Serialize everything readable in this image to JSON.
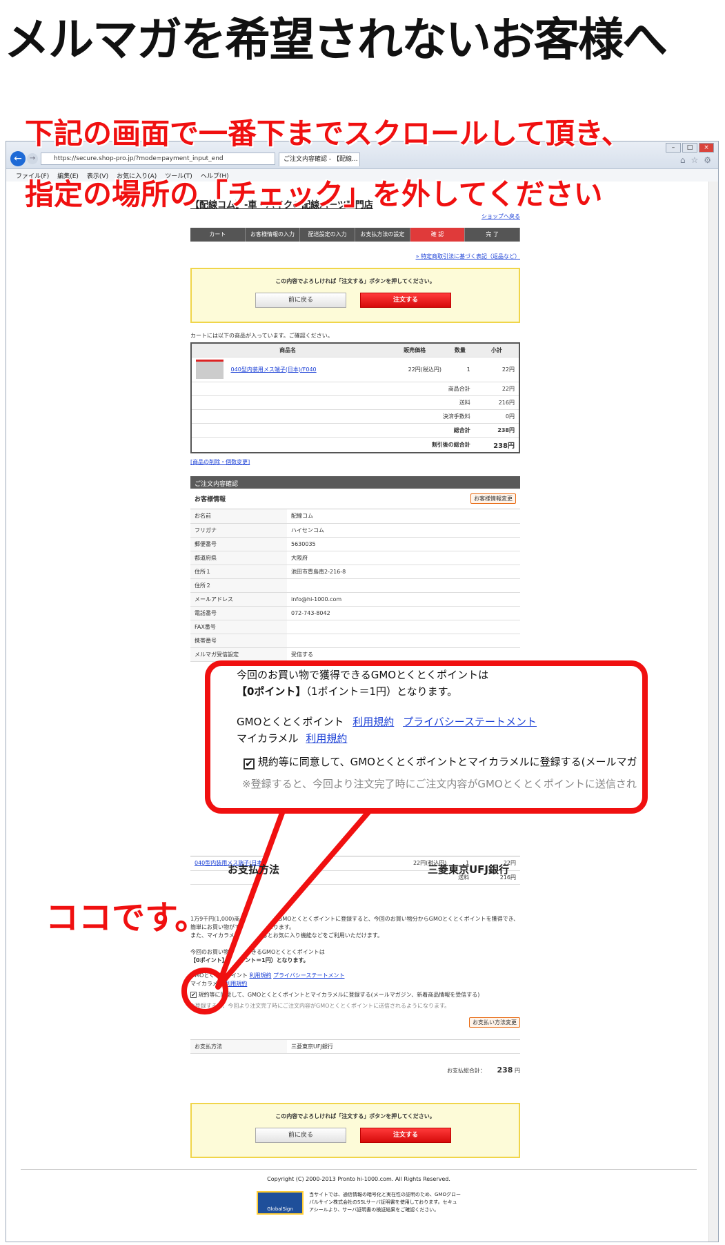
{
  "heading": "メルマガを希望されないお客様へ",
  "instruction_line1": "下記の画面で一番下までスクロールして頂き、",
  "instruction_line2": "指定の場所の「チェック」を外してください",
  "here_label": "ココです。",
  "browser": {
    "url": "https://secure.shop-pro.jp/?mode=payment_input_end",
    "tab_title": "ご注文内容確認 - 【配線...",
    "menu": [
      "ファイル(F)",
      "編集(E)",
      "表示(V)",
      "お気に入り(A)",
      "ツール(T)",
      "ヘルプ(H)"
    ]
  },
  "shop": {
    "title": "【配線コム】-車・バイクの配線パーツ専門店",
    "back_to_shop": "ショップへ戻る",
    "steps": [
      "カート",
      "お客様情報の入力",
      "配送設定の入力",
      "お支払方法の設定",
      "確 認",
      "完 了"
    ],
    "law_link": "» 特定商取引法に基づく表記（返品など）",
    "confirm_message": "この内容でよろしければ「注文する」ボタンを押してください。",
    "back_button": "前に戻る",
    "order_button": "注文する",
    "cart_intro": "カートには以下の商品が入っています。ご確認ください。",
    "cart_headers": [
      "商品名",
      "販売価格",
      "数量",
      "小計"
    ],
    "cart_item": {
      "name": "040型内装用メス端子(日本)/F040",
      "price": "22円(税込円)",
      "qty": "1",
      "subtotal": "22円"
    },
    "totals": [
      {
        "label": "商品合計",
        "value": "22円"
      },
      {
        "label": "送料",
        "value": "216円"
      },
      {
        "label": "決済手数料",
        "value": "0円"
      },
      {
        "label": "総合計",
        "value": "238円"
      },
      {
        "label": "割引後の総合計",
        "value": "238円"
      }
    ],
    "change_items_link": "[商品の削除・個数変更]",
    "order_section_title": "ご注文内容確認",
    "customer_info_title": "お客様情報",
    "customer_change_button": "お客様情報変更",
    "customer_rows": [
      {
        "label": "お名前",
        "value": "配線コム"
      },
      {
        "label": "フリガナ",
        "value": "ハイセンコム"
      },
      {
        "label": "郵便番号",
        "value": "5630035"
      },
      {
        "label": "都道府県",
        "value": "大阪府"
      },
      {
        "label": "住所１",
        "value": "池田市豊島南2-216-8"
      },
      {
        "label": "住所２",
        "value": ""
      },
      {
        "label": "メールアドレス",
        "value": "info@hi-1000.com"
      },
      {
        "label": "電話番号",
        "value": "072-743-8042"
      },
      {
        "label": "FAX番号",
        "value": ""
      },
      {
        "label": "携帯番号",
        "value": ""
      },
      {
        "label": "メルマガ受信設定",
        "value": "受信する"
      }
    ],
    "lower_item": {
      "name": "040型内装用メス端子(日本)/F040",
      "price": "22円(税込円)",
      "qty": "1",
      "subtotal": "22円"
    },
    "lower_shipping": {
      "label": "送料",
      "value": "216円"
    },
    "gmo_text1": "1万9千円(1,000)商品で獲得できるGMOとくとくポイントに登録すると、今回のお買い物分からGMOとくとくポイントを獲得でき、簡単にお買い物ができるようになります。",
    "gmo_text2": "また、マイカラメルに登録するとお気に入り機能などをご利用いただけます。",
    "gmo_points_line1": "今回のお買い物で獲得できるGMOとくとくポイントは",
    "gmo_points_line2": "【0ポイント】（1ポイント＝1円）となります。",
    "gmo_terms_label": "GMOとくとくポイント",
    "terms_link": "利用規約",
    "privacy_link": "プライバシーステートメント",
    "mycaramel_label": "マイカラメル",
    "consent_text": "規約等に同意して、GMOとくとくポイントとマイカラメルに登録する(メールマガジン、新着商品情報を受信する)",
    "consent_note": "※登録すると、今回より注文完了時にご注文内容がGMOとくとくポイントに送信されるようになります。",
    "payment_change_button": "お支払い方法変更",
    "payment_label": "お支払方法",
    "payment_value": "三菱東京UFJ銀行",
    "grand_total_label": "お支払総合計：",
    "grand_total_value": "238",
    "grand_total_unit": "円",
    "copyright": "Copyright (C) 2000-2013 Pronto hi-1000.com. All Rights Reserved.",
    "ssl_text": "当サイトでは、通信情報の暗号化と実在性の証明のため、GMOグローバルサイン株式会社のSSLサーバ証明書を使用しております。セキュアシールより、サーバ証明書の検証結果をご確認ください。",
    "ssl_badge": "GlobalSign"
  },
  "callout": {
    "points_line": "今回のお買い物で獲得できるGMOとくとくポイントは",
    "points_bold": "【0ポイント】",
    "points_rest": "（1ポイント＝1円）となります。",
    "gmo_label": "GMOとくとくポイント",
    "terms": "利用規約",
    "privacy": "プライバシーステートメント",
    "mycaramel": "マイカラメル",
    "consent": "規約等に同意して、GMOとくとくポイントとマイカラメルに登録する(メールマガ",
    "note": "※登録すると、今回より注文完了時にご注文内容がGMOとくとくポイントに送信され",
    "bottom_left": "お支払方法",
    "bottom_right": "三菱東京UFJ銀行"
  },
  "colors": {
    "accent_red": "#f01010",
    "order_red": "#d60b0b",
    "step_active": "#e03a3a",
    "link_blue": "#1a3fd6"
  }
}
